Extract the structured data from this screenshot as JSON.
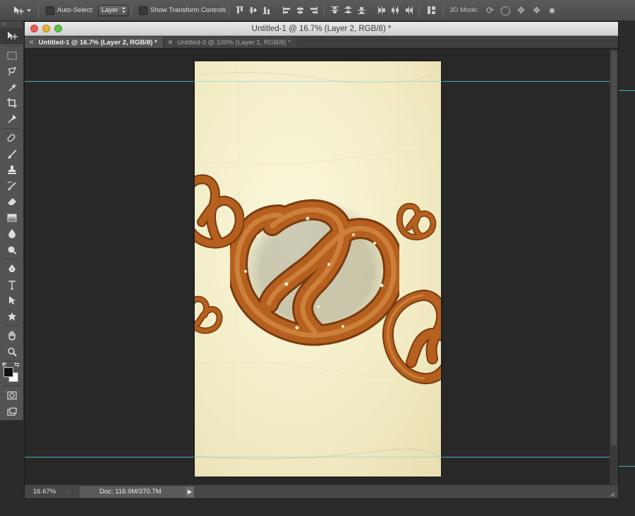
{
  "options_bar": {
    "auto_select_label": "Auto-Select:",
    "auto_select_value": "Layer",
    "show_transform_label": "Show Transform Controls",
    "mode_label": "3D Mode:"
  },
  "tools": [
    {
      "name": "move-tool-icon"
    },
    {
      "name": "rectangular-marquee-icon"
    },
    {
      "name": "lasso-icon"
    },
    {
      "name": "magic-wand-icon"
    },
    {
      "name": "crop-icon"
    },
    {
      "name": "eyedropper-icon"
    },
    {
      "name": "healing-brush-icon"
    },
    {
      "name": "brush-icon"
    },
    {
      "name": "clone-stamp-icon"
    },
    {
      "name": "history-brush-icon"
    },
    {
      "name": "eraser-icon"
    },
    {
      "name": "gradient-icon"
    },
    {
      "name": "blur-icon"
    },
    {
      "name": "dodge-icon"
    },
    {
      "name": "pen-icon"
    },
    {
      "name": "type-icon"
    },
    {
      "name": "path-selection-icon"
    },
    {
      "name": "custom-shape-icon"
    },
    {
      "name": "hand-icon"
    },
    {
      "name": "zoom-icon"
    }
  ],
  "window": {
    "title": "Untitled-1 @ 16.7% (Layer 2, RGB/8) *"
  },
  "tabs": [
    {
      "label": "Untitled-1 @ 16.7% (Layer 2, RGB/8) *",
      "active": true
    },
    {
      "label": "Untitled-3 @ 100% (Layer 1, RGB/8) *",
      "active": false
    }
  ],
  "status": {
    "zoom": "16.67%",
    "doc_size": "Doc: 116.9M/370.7M"
  },
  "colors": {
    "guide": "#3fb3b5",
    "canvas_paper": "#f3edc6",
    "pretzel": "#b8621e"
  }
}
